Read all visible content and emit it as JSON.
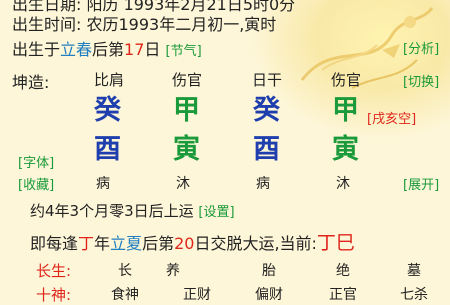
{
  "info": {
    "line1": "出生日期: 阳历 1993年2月21日5时0分",
    "line2_label": "出生时间:",
    "line2_value": "农历1993年二月初一,寅时",
    "line3_prefix": "出生于",
    "line3_term": "立春",
    "line3_mid": "后第",
    "line3_day": "17",
    "line3_suffix": "日",
    "line3_tag": "[节气]",
    "analyze": "[分析]"
  },
  "chart": {
    "label": "坤造:",
    "switch": "[切换]",
    "headers": [
      "比肩",
      "伤官",
      "日干",
      "伤官"
    ],
    "stems": [
      "癸",
      "甲",
      "癸",
      "甲"
    ],
    "stem_colors": [
      "#1f3fae",
      "#1a9a3a",
      "#1f3fae",
      "#1a9a3a"
    ],
    "void_tag": "[戌亥空]",
    "font_tag": "[字体]",
    "collect_tag": "[收藏]",
    "branches": [
      "酉",
      "寅",
      "酉",
      "寅"
    ],
    "branch_colors": [
      "#1f3fae",
      "#1a9a3a",
      "#1f3fae",
      "#1a9a3a"
    ],
    "stages": [
      "病",
      "沐",
      "病",
      "沐"
    ],
    "expand": "[展开]"
  },
  "luck": {
    "start_text": "约4年3个月零3日后上运",
    "settings": "[设置]",
    "meet_prefix": "即每逢",
    "meet_stem": "丁",
    "meet_mid": "年",
    "meet_term": "立夏",
    "meet_after": "后第",
    "meet_day": "20",
    "meet_suffix": "日交脱大运,当前:",
    "current": "丁巳"
  },
  "table": {
    "row1_label": "长生:",
    "row1": [
      "长",
      "养",
      "胎",
      "绝",
      "墓"
    ],
    "row2_label": "十神:",
    "row2": [
      "食神",
      "正财",
      "偏财",
      "正官",
      "七杀"
    ]
  }
}
